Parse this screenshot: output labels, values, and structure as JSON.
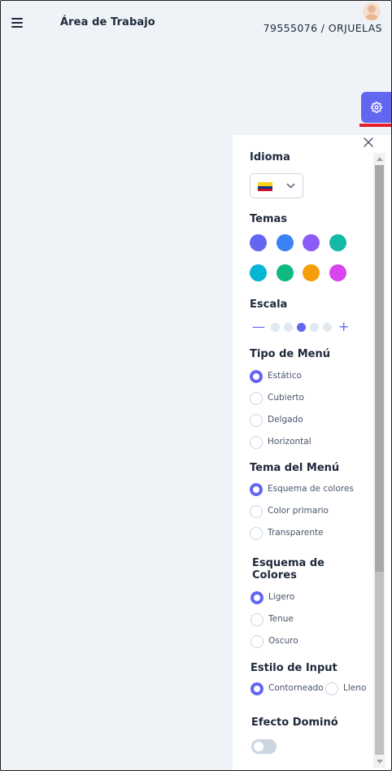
{
  "topbar": {
    "app_title": "Área de Trabajo",
    "user_id": "79555076 / ORJUELAS",
    "menu_icon": "hamburger-icon",
    "avatar_icon": "user-avatar"
  },
  "config_button": {
    "icon": "gear-icon",
    "color": "#6366f1"
  },
  "config_panel": {
    "close_icon": "close-icon",
    "idioma": {
      "title": "Idioma",
      "flag": "colombia-flag",
      "dropdown_icon": "chevron-down-icon"
    },
    "temas": {
      "title": "Temas",
      "colors": [
        "#6366f1",
        "#3b82f6",
        "#8b5cf6",
        "#14b8a6",
        "#06b6d4",
        "#10b981",
        "#f59e0b",
        "#d946ef"
      ]
    },
    "escala": {
      "title": "Escala",
      "levels": 5,
      "active_level": 3,
      "minus_icon": "minus-icon",
      "plus_icon": "plus-icon"
    },
    "tipo_menu": {
      "title": "Tipo de Menú",
      "options": [
        "Estático",
        "Cubierto",
        "Delgado",
        "Horizontal"
      ],
      "selected": "Estático"
    },
    "tema_menu": {
      "title": "Tema del Menú",
      "options": [
        "Esquema de colores",
        "Color primario",
        "Transparente"
      ],
      "selected": "Esquema de colores"
    },
    "esquema_colores": {
      "title": "Esquema de Colores",
      "options": [
        "Ligero",
        "Tenue",
        "Oscuro"
      ],
      "selected": "Ligero"
    },
    "estilo_input": {
      "title": "Estilo de Input",
      "options": [
        "Contorneado",
        "Lleno"
      ],
      "selected": "Contorneado"
    },
    "efecto_domino": {
      "title": "Efecto Dominó",
      "enabled": false
    }
  }
}
